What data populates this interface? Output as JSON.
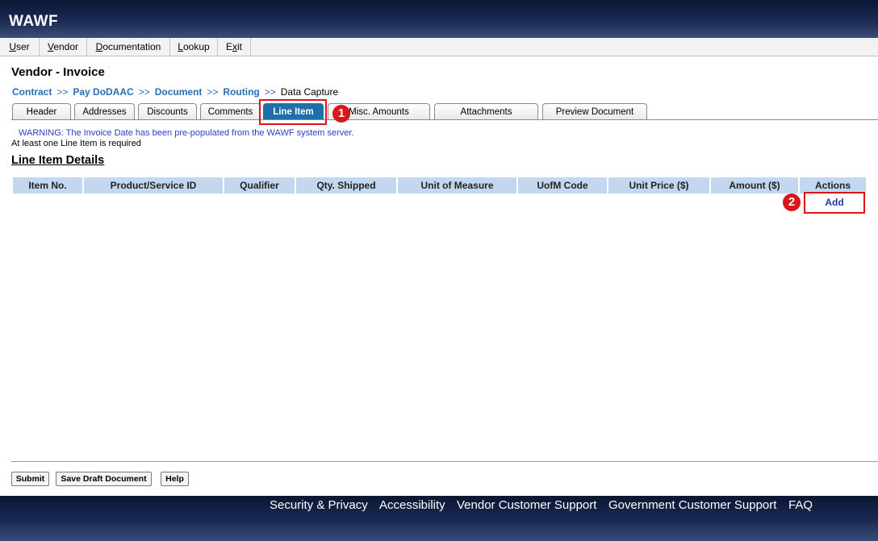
{
  "app": {
    "logo": "WAWF"
  },
  "menu": {
    "items": [
      {
        "pre": "",
        "ul": "U",
        "post": "ser"
      },
      {
        "pre": "",
        "ul": "V",
        "post": "endor"
      },
      {
        "pre": "",
        "ul": "D",
        "post": "ocumentation"
      },
      {
        "pre": "",
        "ul": "L",
        "post": "ookup"
      },
      {
        "pre": "E",
        "ul": "x",
        "post": "it"
      }
    ]
  },
  "page": {
    "title": "Vendor - Invoice"
  },
  "breadcrumb": {
    "items": [
      "Contract",
      "Pay DoDAAC",
      "Document",
      "Routing"
    ],
    "separator": ">>",
    "current": "Data Capture"
  },
  "tabs": {
    "items": [
      "Header",
      "Addresses",
      "Discounts",
      "Comments",
      "Line Item",
      "Misc. Amounts",
      "Attachments",
      "Preview Document"
    ],
    "active": "Line Item"
  },
  "annotations": {
    "badge1": "1",
    "badge2": "2"
  },
  "messages": {
    "warning": "WARNING: The Invoice Date has been pre-populated from the WAWF system server.",
    "required": "At least one Line Item is required"
  },
  "line_items": {
    "section_title": "Line Item Details",
    "columns": [
      "Item No.",
      "Product/Service ID",
      "Qualifier",
      "Qty. Shipped",
      "Unit of Measure",
      "UofM Code",
      "Unit Price ($)",
      "Amount ($)",
      "Actions"
    ],
    "add_label": "Add"
  },
  "buttons": {
    "submit": "Submit",
    "save_draft": "Save Draft Document",
    "help": "Help"
  },
  "footer": {
    "links": [
      "Security & Privacy",
      "Accessibility",
      "Vendor Customer Support",
      "Government Customer Support",
      "FAQ"
    ]
  },
  "colors": {
    "active_tab": "#1f6fa9",
    "header_cell": "#c3d7ef",
    "annotation_red": "#d9161c",
    "link_blue": "#2a6db5"
  }
}
